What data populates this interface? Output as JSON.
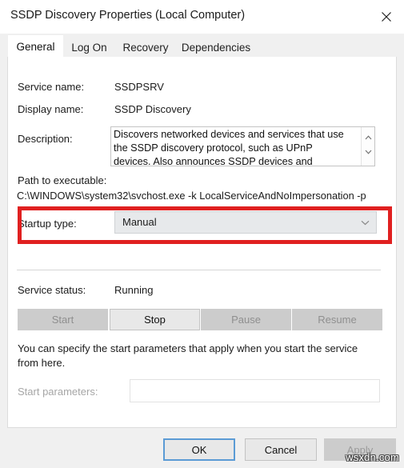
{
  "window": {
    "title": "SSDP Discovery Properties (Local Computer)",
    "close_icon": "close-icon"
  },
  "tabs": [
    {
      "label": "General",
      "active": true
    },
    {
      "label": "Log On",
      "active": false
    },
    {
      "label": "Recovery",
      "active": false
    },
    {
      "label": "Dependencies",
      "active": false
    }
  ],
  "general": {
    "service_name_label": "Service name:",
    "service_name_value": "SSDPSRV",
    "display_name_label": "Display name:",
    "display_name_value": "SSDP Discovery",
    "description_label": "Description:",
    "description_value": "Discovers networked devices and services that use the SSDP discovery protocol, such as UPnP devices. Also announces SSDP devices and services running",
    "scroll_up_icon": "chevron-up-icon",
    "scroll_down_icon": "chevron-down-icon",
    "path_label": "Path to executable:",
    "path_value": "C:\\WINDOWS\\system32\\svchost.exe -k LocalServiceAndNoImpersonation -p",
    "startup_type_label": "Startup type:",
    "startup_type_value": "Manual",
    "startup_dropdown_icon": "chevron-down-icon",
    "status_label": "Service status:",
    "status_value": "Running",
    "buttons": [
      {
        "label": "Start",
        "enabled": false
      },
      {
        "label": "Stop",
        "enabled": true
      },
      {
        "label": "Pause",
        "enabled": false
      },
      {
        "label": "Resume",
        "enabled": false
      }
    ],
    "help_text": "You can specify the start parameters that apply when you start the service from here.",
    "start_parameters_label": "Start parameters:",
    "start_parameters_value": ""
  },
  "footer": {
    "ok_label": "OK",
    "cancel_label": "Cancel",
    "apply_label": "Apply"
  },
  "watermark": "wsxdn.com",
  "colors": {
    "annotation": "#e02020",
    "focus_border": "#5b9bd5"
  }
}
